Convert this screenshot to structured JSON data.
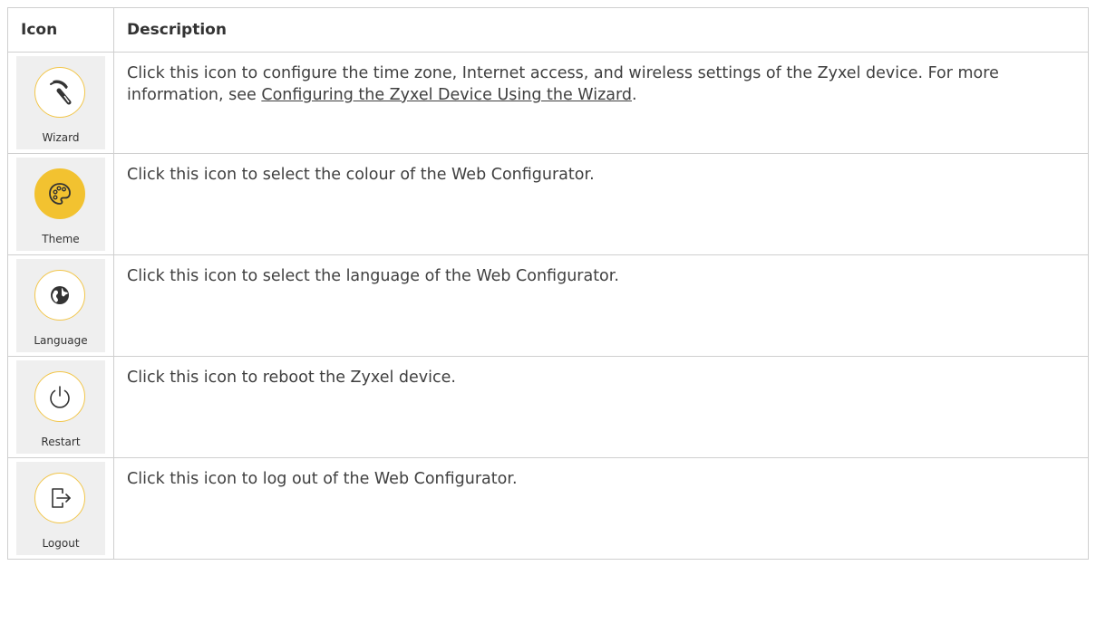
{
  "table": {
    "header": {
      "icon": "Icon",
      "description": "Description"
    },
    "rows": [
      {
        "label": "Wizard",
        "icon": "wand-icon",
        "description": "Click this icon to configure the time zone, Internet access, and wireless settings of the Zyxel device. For more information, see ",
        "link": "Configuring the Zyxel Device Using the Wizard",
        "after": "."
      },
      {
        "label": "Theme",
        "icon": "palette-icon",
        "description": "Click this icon to select the colour of the Web Configurator."
      },
      {
        "label": "Language",
        "icon": "globe-icon",
        "description": "Click this icon to select the language of the Web Configurator."
      },
      {
        "label": "Restart",
        "icon": "power-icon",
        "description": "Click this icon to reboot the Zyxel device."
      },
      {
        "label": "Logout",
        "icon": "logout-icon",
        "description": "Click this icon to log out of the Web Configurator."
      }
    ]
  },
  "colors": {
    "accent": "#f2c230",
    "tile_background": "#efefef",
    "border": "#cfcfcf"
  }
}
